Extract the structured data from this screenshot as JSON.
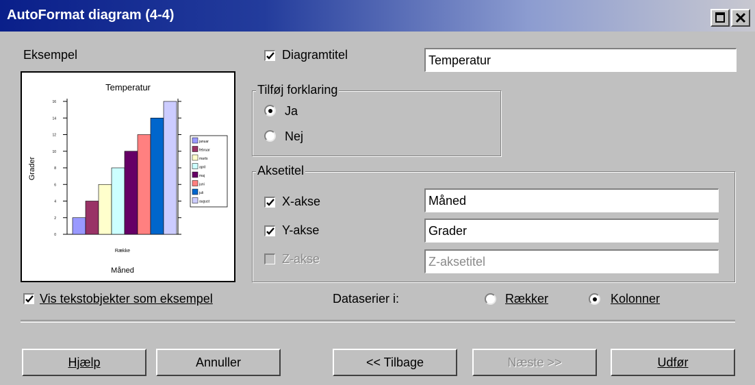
{
  "window": {
    "title": "AutoFormat diagram  (4-4)"
  },
  "preview": {
    "label": "Eksempel",
    "show_text_label": "Vis tekstobjekter som eksempel",
    "show_text_checked": true
  },
  "chart_data": {
    "type": "bar",
    "title": "Temperatur",
    "xlabel": "Måned",
    "ylabel": "Grader",
    "category_label": "Række",
    "categories": [
      "Række"
    ],
    "series": [
      {
        "name": "januar",
        "values": [
          2
        ]
      },
      {
        "name": "februar",
        "values": [
          4
        ]
      },
      {
        "name": "marts",
        "values": [
          6
        ]
      },
      {
        "name": "april",
        "values": [
          8
        ]
      },
      {
        "name": "maj",
        "values": [
          10
        ]
      },
      {
        "name": "juni",
        "values": [
          12
        ]
      },
      {
        "name": "juli",
        "values": [
          14
        ]
      },
      {
        "name": "august",
        "values": [
          16
        ]
      }
    ],
    "colors": [
      "#9999ff",
      "#993366",
      "#ffffcc",
      "#ccffff",
      "#660066",
      "#ff8080",
      "#0066cc",
      "#ccccff"
    ],
    "yticks": [
      "0",
      "2",
      "4",
      "6",
      "8",
      "10",
      "12",
      "14",
      "16"
    ],
    "ylim": [
      0,
      16
    ],
    "legend": "right",
    "grid": false
  },
  "diagram_title": {
    "label": "Diagramtitel",
    "checked": true,
    "value": "Temperatur"
  },
  "legend_group": {
    "title": "Tilføj forklaring",
    "options": [
      {
        "label": "Ja",
        "selected": true
      },
      {
        "label": "Nej",
        "selected": false
      }
    ]
  },
  "axis_group": {
    "title": "Aksetitel",
    "x": {
      "label": "X-akse",
      "checked": true,
      "value": "Måned"
    },
    "y": {
      "label": "Y-akse",
      "checked": true,
      "value": "Grader"
    },
    "z": {
      "label": "Z-akse",
      "checked": false,
      "placeholder": "Z-aksetitel",
      "disabled": true
    }
  },
  "data_series": {
    "label": "Dataserier i:",
    "rows_label": "Rækker",
    "rows_selected": false,
    "cols_label": "Kolonner",
    "cols_selected": true
  },
  "buttons": {
    "help": "Hjælp",
    "cancel": "Annuller",
    "back": "<< Tilbage",
    "next": "Næste >>",
    "finish": "Udfør"
  },
  "icons": {
    "minimize": "minimize-icon",
    "close": "close-icon",
    "check": "check-icon"
  }
}
